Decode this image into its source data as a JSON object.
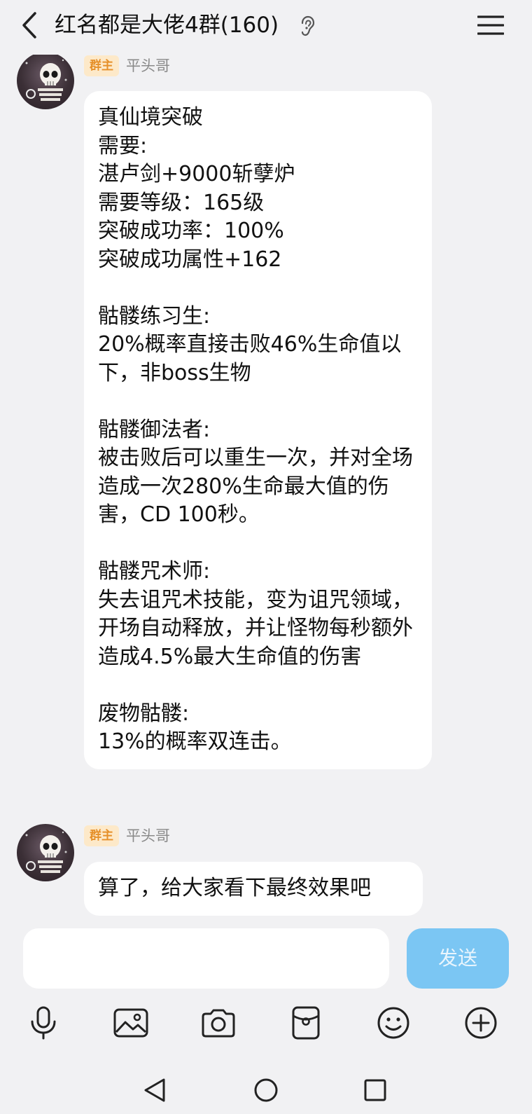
{
  "header": {
    "title": "红名都是大佬4群(160)"
  },
  "messages": [
    {
      "badge": "群主",
      "sender": "平头哥",
      "text": "真仙境突破\n需要:\n湛卢剑+9000斩孽炉\n需要等级：165级\n突破成功率：100%\n突破成功属性+162\n\n骷髅练习生:\n20%概率直接击败46%生命值以下，非boss生物\n\n骷髅御法者:\n被击败后可以重生一次，并对全场造成一次280%生命最大值的伤害，CD 100秒。\n\n骷髅咒术师:\n失去诅咒术技能，变为诅咒领域，开场自动释放，并让怪物每秒额外造成4.5%最大生命值的伤害\n\n废物骷髅:\n13%的概率双连击。"
    },
    {
      "badge": "群主",
      "sender": "平头哥",
      "text": "算了，给大家看下最终效果吧"
    }
  ],
  "input": {
    "placeholder": "",
    "send_label": "发送"
  },
  "toolbar": [
    "microphone-icon",
    "image-icon",
    "camera-icon",
    "red-packet-icon",
    "emoji-icon",
    "plus-icon"
  ],
  "nav": [
    "back-triangle-icon",
    "home-circle-icon",
    "recents-square-icon"
  ]
}
